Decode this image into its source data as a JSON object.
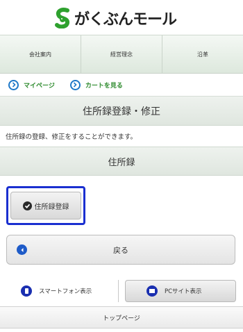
{
  "header": {
    "logo_text": "がくぶんモール"
  },
  "gnav": [
    {
      "label": "会社案内"
    },
    {
      "label": "経営理念"
    },
    {
      "label": "沿革"
    }
  ],
  "subnav": {
    "mypage": "マイページ",
    "cart": "カートを見る"
  },
  "page_title": "住所録登録・修正",
  "description": "住所録の登録、修正をすることができます。",
  "section_title": "住所録",
  "register_button": "住所録登録",
  "back_button": "戻る",
  "device": {
    "smartphone": "スマートフォン表示",
    "pc": "PCサイト表示"
  },
  "top_page": "トップページ",
  "colors": {
    "accent_green": "#2e8b2e",
    "focus_blue": "#1a2fd0",
    "icon_blue": "#1e5bc8"
  }
}
